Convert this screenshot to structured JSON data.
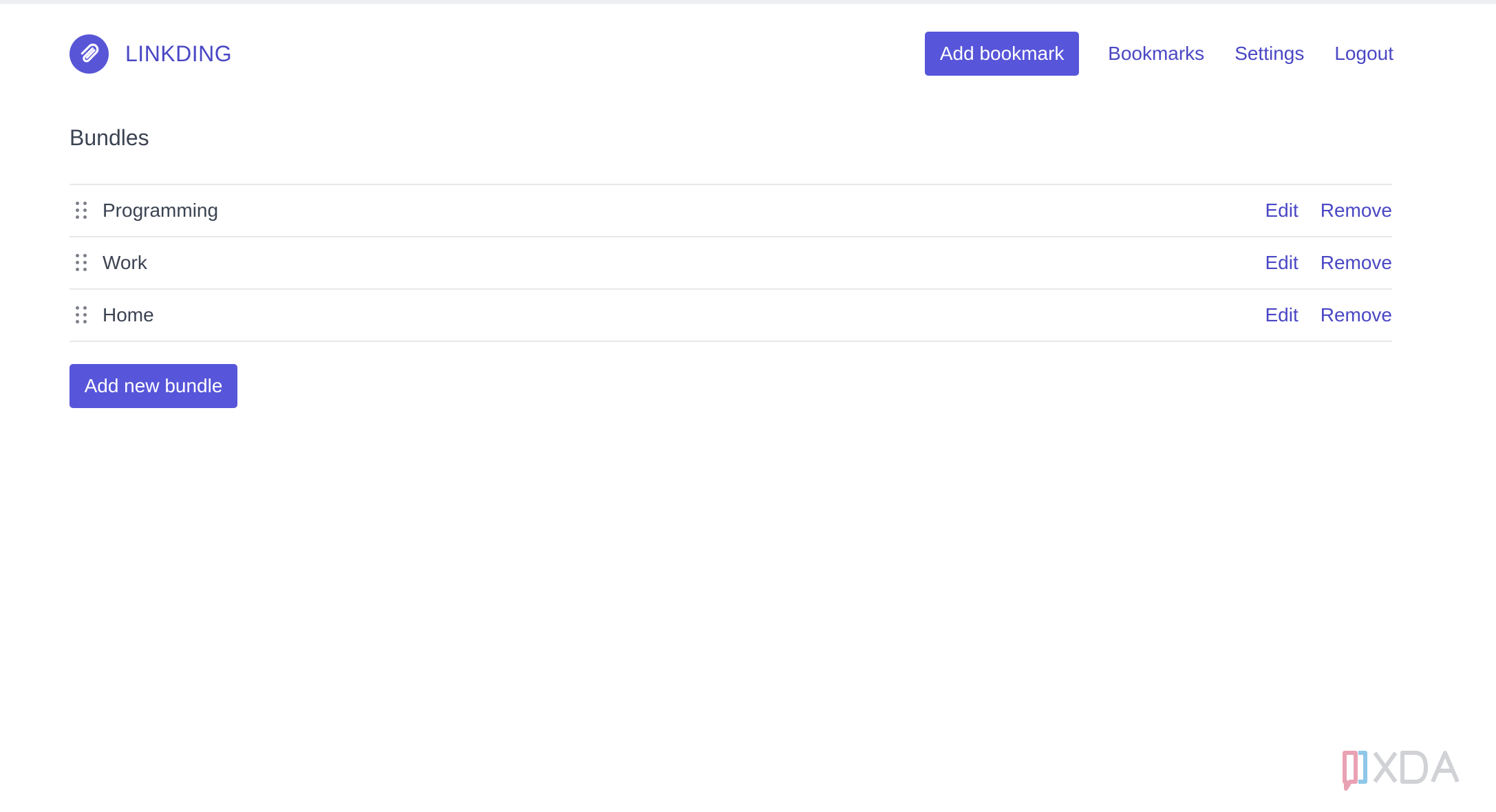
{
  "brand": {
    "name": "LINKDING",
    "logo_icon": "paperclip-icon"
  },
  "nav": {
    "add_bookmark": "Add bookmark",
    "bookmarks": "Bookmarks",
    "settings": "Settings",
    "logout": "Logout"
  },
  "page": {
    "title": "Bundles"
  },
  "bundles": [
    {
      "name": "Programming",
      "edit": "Edit",
      "remove": "Remove"
    },
    {
      "name": "Work",
      "edit": "Edit",
      "remove": "Remove"
    },
    {
      "name": "Home",
      "edit": "Edit",
      "remove": "Remove"
    }
  ],
  "actions": {
    "add_new_bundle": "Add new bundle"
  },
  "watermark": {
    "text": "XDA"
  },
  "colors": {
    "accent": "#5755d9",
    "link": "#4a47c4",
    "text": "#3b4351",
    "divider": "#e7e8ec"
  }
}
